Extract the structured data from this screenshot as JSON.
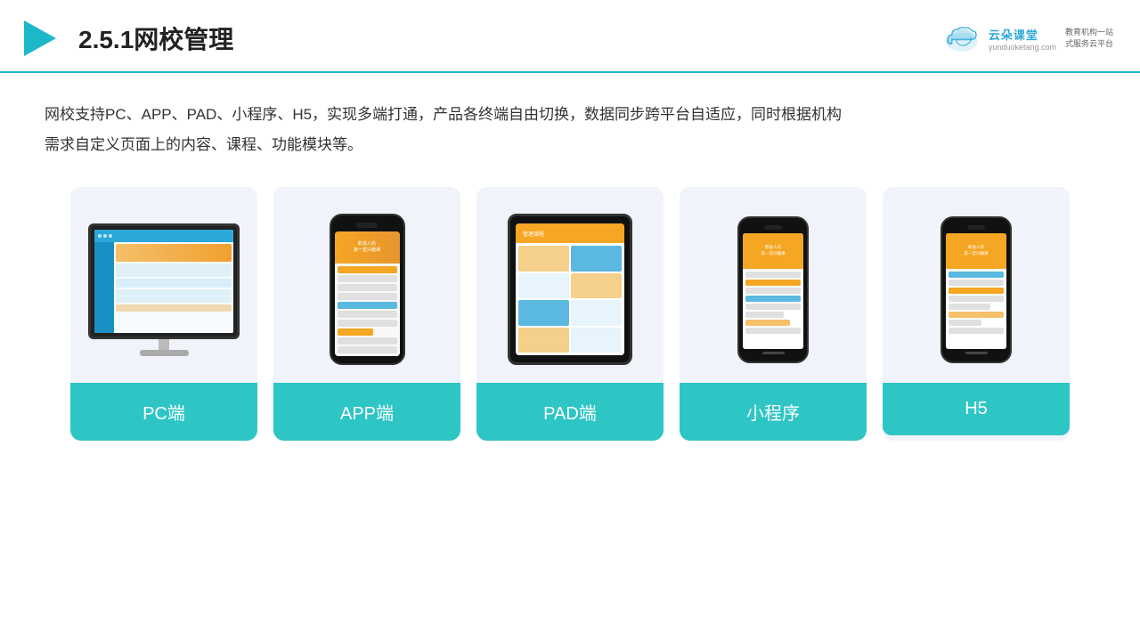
{
  "header": {
    "title": "2.5.1网校管理",
    "brand": {
      "name": "云朵课堂",
      "url": "yunduoketang.com",
      "slogan_line1": "教育机构一站",
      "slogan_line2": "式服务云平台"
    }
  },
  "main": {
    "description": "网校支持PC、APP、PAD、小程序、H5，实现多端打通，产品各终端自由切换，数据同步跨平台自适应，同时根据机构\n需求自定义页面上的内容、课程、功能模块等。"
  },
  "cards": [
    {
      "id": "pc",
      "label": "PC端",
      "device": "pc"
    },
    {
      "id": "app",
      "label": "APP端",
      "device": "phone"
    },
    {
      "id": "pad",
      "label": "PAD端",
      "device": "tablet"
    },
    {
      "id": "miniprogram",
      "label": "小程序",
      "device": "phone-small"
    },
    {
      "id": "h5",
      "label": "H5",
      "device": "phone-small"
    }
  ],
  "colors": {
    "accent": "#2ec5c5",
    "header_border": "#1db8c8",
    "brand_blue": "#2ba8d8"
  }
}
